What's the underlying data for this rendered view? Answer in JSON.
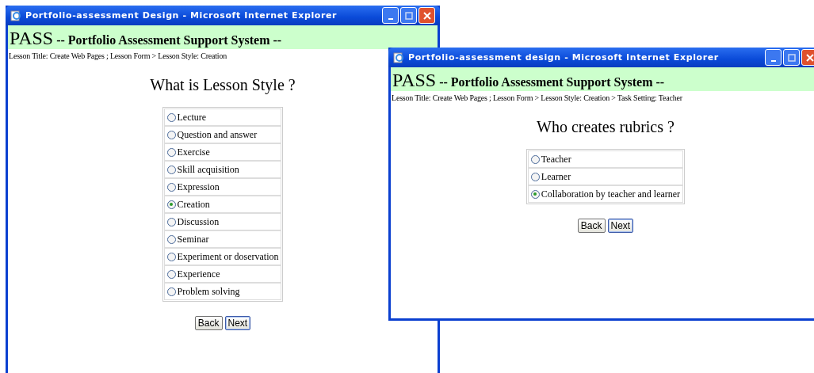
{
  "windows": [
    {
      "title": "Portfolio-assessment Design - Microsoft Internet Explorer",
      "header": {
        "logo": "PASS",
        "subtitle": "-- Portfolio Assessment Support System --"
      },
      "breadcrumb": "Lesson Title: Create Web Pages ; Lesson Form > Lesson Style: Creation",
      "question": "What is Lesson Style ?",
      "options": [
        {
          "label": "Lecture",
          "selected": false
        },
        {
          "label": "Question and answer",
          "selected": false
        },
        {
          "label": "Exercise",
          "selected": false
        },
        {
          "label": "Skill acquisition",
          "selected": false
        },
        {
          "label": "Expression",
          "selected": false
        },
        {
          "label": "Creation",
          "selected": true
        },
        {
          "label": "Discussion",
          "selected": false
        },
        {
          "label": "Seminar",
          "selected": false
        },
        {
          "label": "Experiment or doservation",
          "selected": false
        },
        {
          "label": "Experience",
          "selected": false
        },
        {
          "label": "Problem solving",
          "selected": false
        }
      ],
      "buttons": [
        "Back",
        "Next"
      ]
    },
    {
      "title": "Portfolio-assessment design - Microsoft Internet Explorer",
      "header": {
        "logo": "PASS",
        "subtitle": "-- Portfolio Assessment Support System --"
      },
      "breadcrumb": "Lesson Title: Create Web Pages ; Lesson Form > Lesson Style: Creation > Task Setting: Teacher",
      "question": "Who creates rubrics ?",
      "options": [
        {
          "label": "Teacher",
          "selected": false
        },
        {
          "label": "Learner",
          "selected": false
        },
        {
          "label": "Collaboration by teacher and learner",
          "selected": true
        }
      ],
      "buttons": [
        "Back",
        "Next"
      ]
    }
  ]
}
